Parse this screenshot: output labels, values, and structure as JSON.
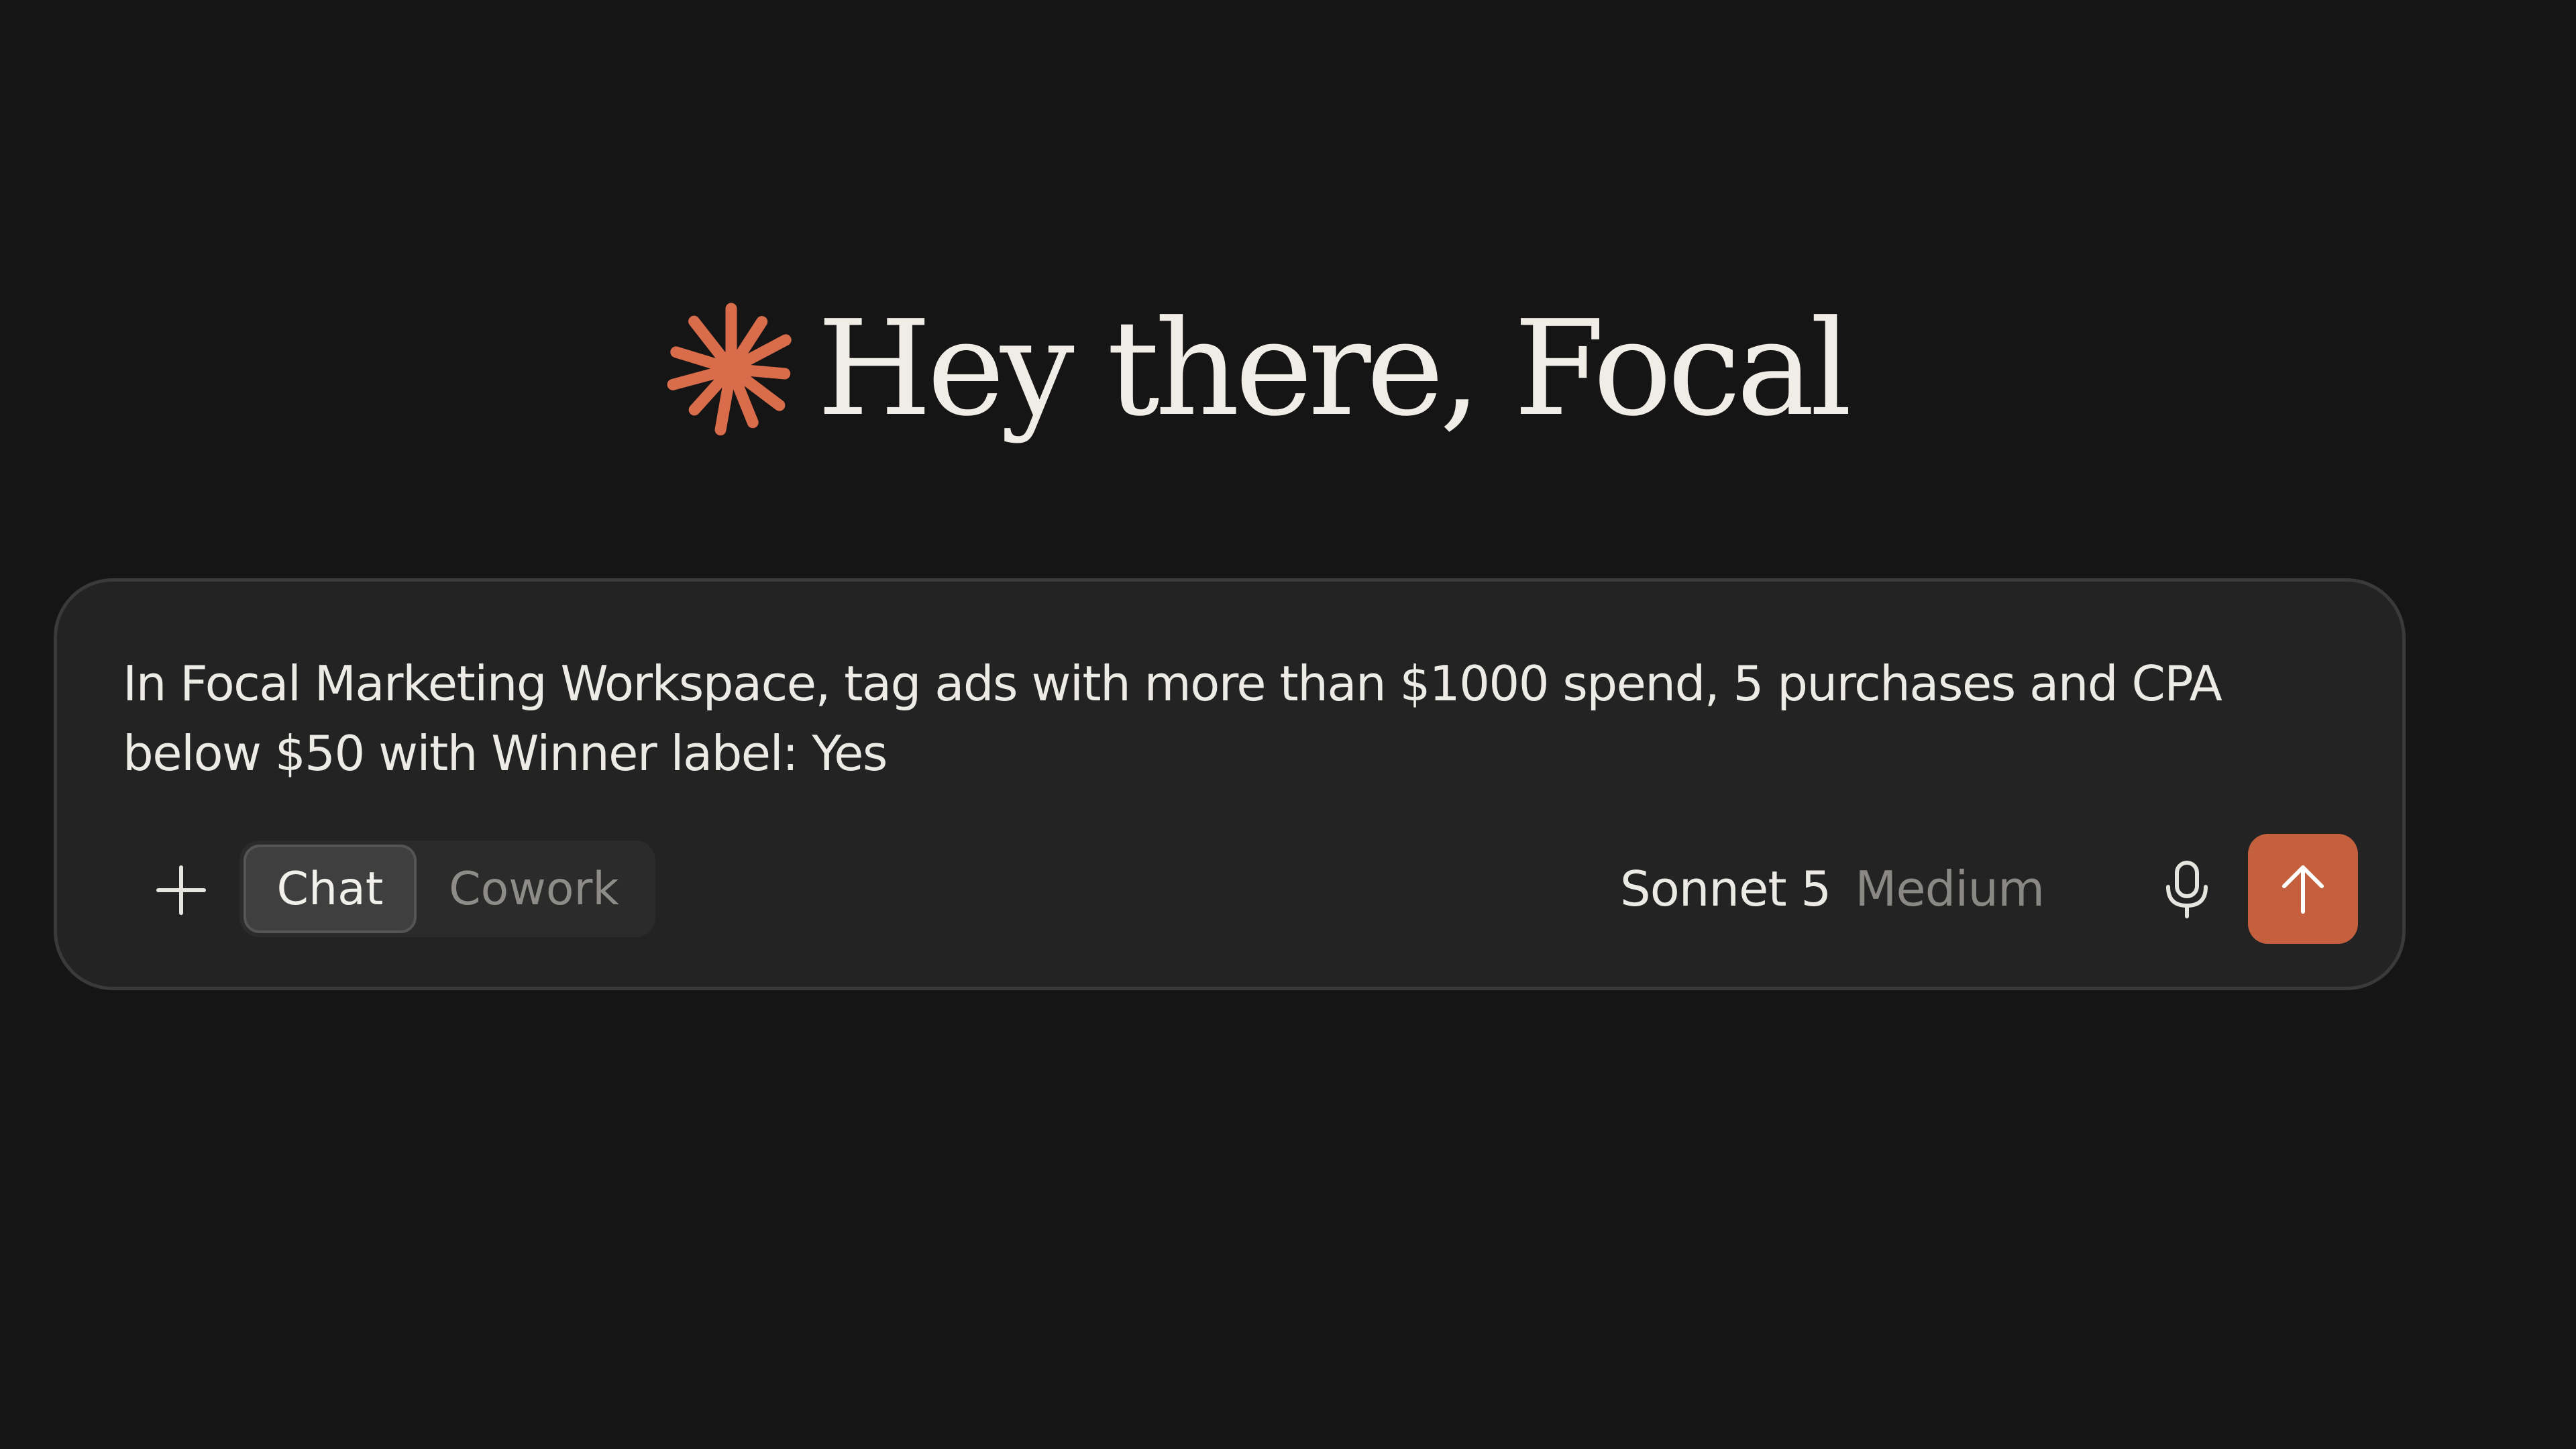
{
  "greeting": {
    "text": "Hey there, Focal",
    "icon": "asterisk-logo-icon",
    "icon_color": "#D96C4A"
  },
  "composer": {
    "prompt_text": "In Focal Marketing Workspace, tag ads with more than $1000 spend, 5 purchases and CPA below $50 with Winner label: Yes",
    "add_icon": "plus-icon",
    "modes": [
      {
        "label": "Chat",
        "selected": true
      },
      {
        "label": "Cowork",
        "selected": false
      }
    ],
    "model": {
      "name": "Sonnet 5",
      "effort": "Medium"
    },
    "mic_icon": "microphone-icon",
    "send_icon": "arrow-up-icon",
    "send_color": "#C5603F"
  }
}
